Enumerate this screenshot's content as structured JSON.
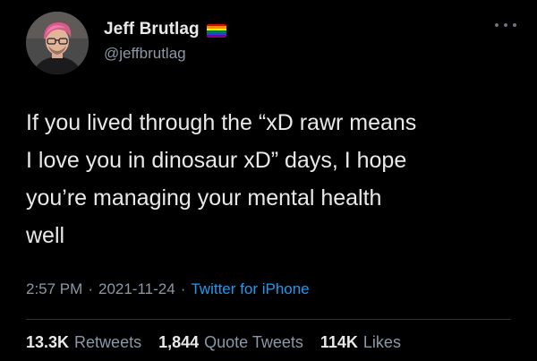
{
  "author": {
    "display_name": "Jeff Brutlag",
    "handle": "@jeffbrutlag",
    "avatar_icon": "profile-photo",
    "badge_icon": "rainbow-flag-icon",
    "flag_colors": [
      "#e40303",
      "#ff8c00",
      "#ffed00",
      "#008026",
      "#004dff",
      "#750787"
    ]
  },
  "menu_icon": "more-options-icon",
  "tweet": {
    "text": "If you lived through the “xD rawr means\nI love you in dinosaur xD” days, I hope\nyou’re managing your mental health\nwell"
  },
  "meta": {
    "time": "2:57 PM",
    "separator": "·",
    "date": "2021-11-24",
    "source": "Twitter for iPhone"
  },
  "stats": {
    "retweets_count": "13.3K",
    "retweets_label": "Retweets",
    "quotes_count": "1,844",
    "quotes_label": "Quote Tweets",
    "likes_count": "114K",
    "likes_label": "Likes"
  },
  "colors": {
    "background": "#000000",
    "text": "#e7e9ea",
    "secondary_text": "#8b98a5",
    "link": "#1d9bf0",
    "divider": "#2f3336"
  }
}
